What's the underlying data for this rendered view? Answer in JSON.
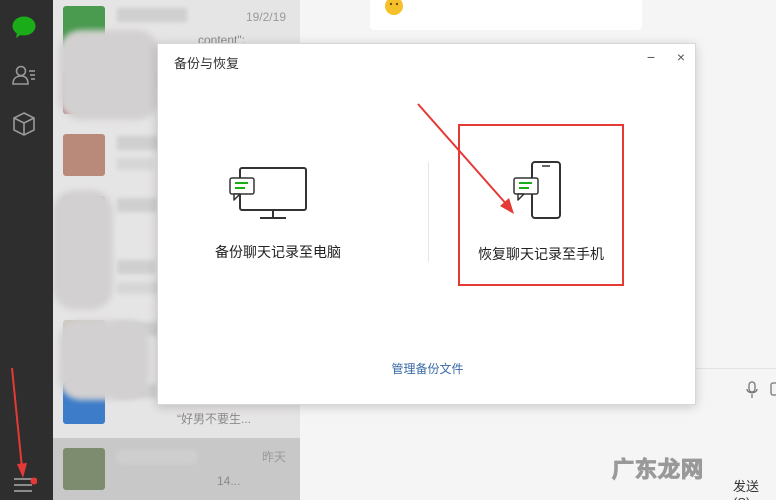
{
  "sidebar": {
    "icons": [
      "chat-icon",
      "contacts-icon",
      "favorites-icon",
      "menu-icon"
    ],
    "accent": "#1aad19"
  },
  "chatlist": {
    "items": [
      {
        "time": "19/2/19",
        "msg": "content\":"
      },
      {
        "time": "",
        "msg": ""
      },
      {
        "time": "",
        "msg": ""
      },
      {
        "time": "",
        "msg": ""
      },
      {
        "time": "",
        "msg": ""
      },
      {
        "time": "",
        "msg": ""
      },
      {
        "time": "",
        "msg": "“好男不要生..."
      },
      {
        "time": "昨天",
        "msg": "14..."
      }
    ]
  },
  "chat": {
    "send_label": "发送(S)"
  },
  "dialog": {
    "title": "备份与恢复",
    "minimize": "−",
    "close": "×",
    "backup_label": "备份聊天记录至电脑",
    "restore_label": "恢复聊天记录至手机",
    "manage_label": "管理备份文件"
  },
  "watermark": "广东龙网",
  "colors": {
    "highlight": "#e53935",
    "link": "#3a6aa8",
    "brand_green": "#1aad19"
  }
}
